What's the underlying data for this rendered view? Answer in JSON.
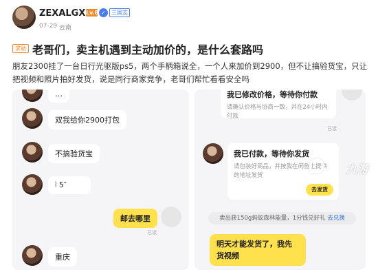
{
  "header": {
    "username": "ZEXALGX27",
    "level_badge": "Lv.8",
    "phone_badge": "三国志",
    "date": "07-29",
    "location": "云南"
  },
  "post": {
    "tag": "求助",
    "title": "老哥们，卖主机遇到主动加价的，是什么套路吗",
    "description": "朋友2300挂了一台日行光驱版ps5，两个手柄箱说全，一个人来加价到2900，但不让搞验货宝，只让把视频和照片拍好发货，说是同行商家竞争，老哥们帮忙看看安全吗"
  },
  "left_chat": {
    "msg_top_partial": "…",
    "msg1": "双我给你2900打包",
    "msg2": "不搞验货宝",
    "msg3_voice": "5″",
    "reply_yellow": "邮去哪里",
    "read1": "已读",
    "msg4": "重庆"
  },
  "right_chat": {
    "card1_title": "我已修改价格，等待你付款",
    "card1_body": "请确认价格与协商一致，并在24小时内付款",
    "read1": "已读",
    "card2_title": "我已付款，等待你发货",
    "card2_body": "请包装好商品，并按我在闲鱼上提供的地址发货",
    "card2_button": "去发货",
    "system_note_text": "卖出获150g蚂蚁森林能量，1分钱兑好礼",
    "system_note_link": "去兑换",
    "reply_yellow": "明天才能发货了，我先",
    "reply_yellow_line2": "货视频"
  },
  "watermark": "九游"
}
